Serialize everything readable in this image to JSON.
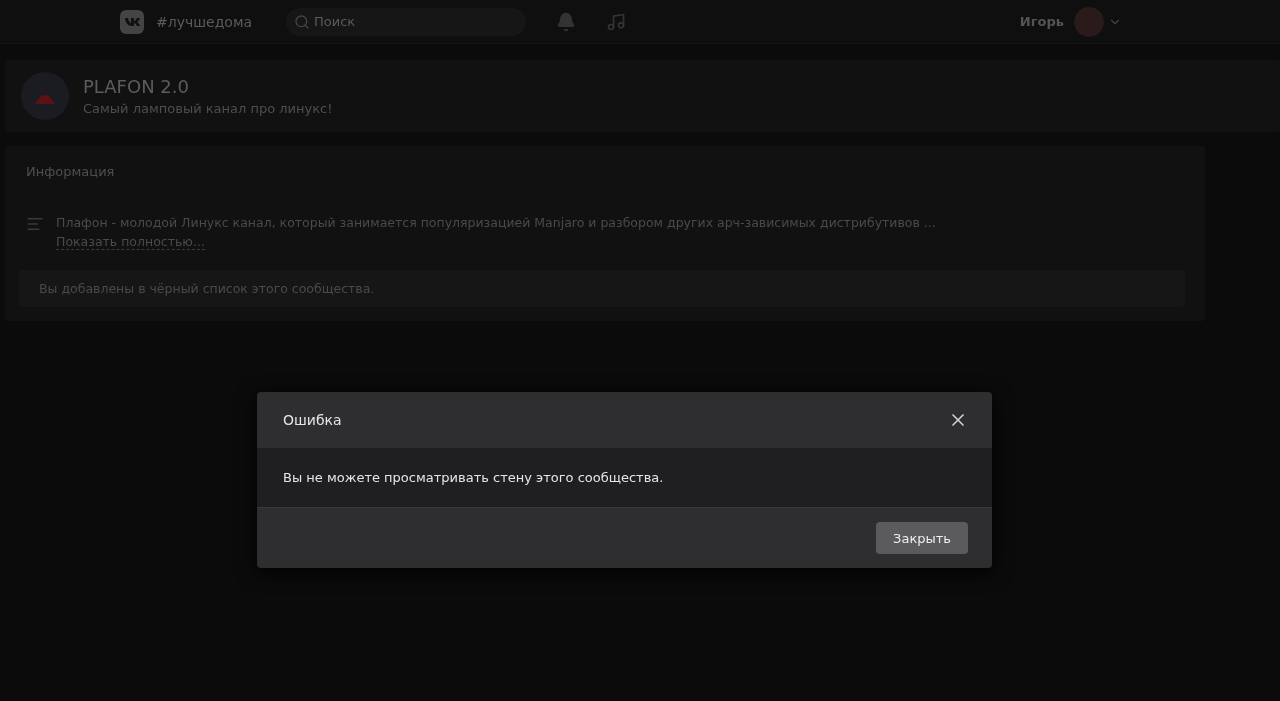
{
  "header": {
    "hashtag": "#лучшедома",
    "search": {
      "placeholder": "Поиск"
    },
    "user": {
      "name": "Игорь"
    }
  },
  "community": {
    "name": "PLAFON 2.0",
    "status": "Самый ламповый канал про линукс!"
  },
  "info": {
    "title": "Информация",
    "description": "Плафон - молодой Линукс канал, который занимается популяризацией Manjaro и разбором других арч-зависимых дистрибутивов ...",
    "more_link": "Показать полностью…",
    "notice": "Вы добавлены в чёрный список этого сообщества."
  },
  "dialog": {
    "title": "Ошибка",
    "message": "Вы не можете просматривать стену этого сообщества.",
    "buttons": [
      "Закрыть"
    ]
  }
}
